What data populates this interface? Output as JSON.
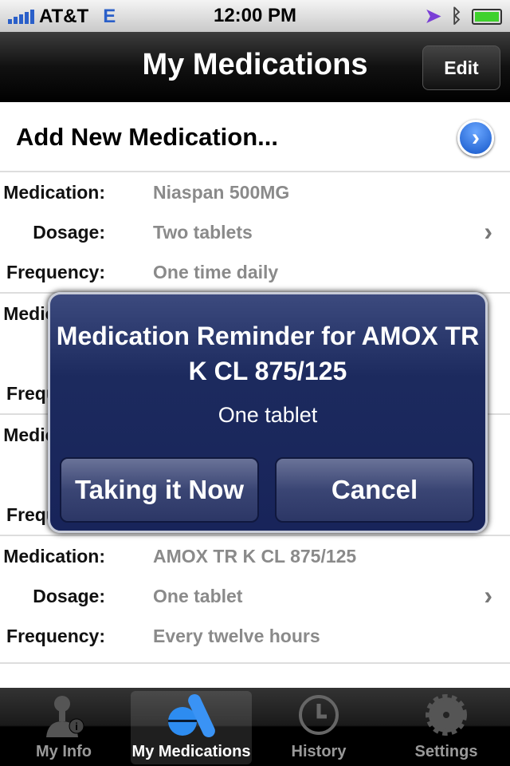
{
  "status": {
    "carrier": "AT&T",
    "network": "E",
    "time": "12:00 PM"
  },
  "nav": {
    "title": "My Medications",
    "edit": "Edit"
  },
  "add": {
    "label": "Add New Medication..."
  },
  "labels": {
    "medication": "Medication:",
    "dosage": "Dosage:",
    "frequency": "Frequency:"
  },
  "meds": [
    {
      "medication": "Niaspan 500MG",
      "dosage": "Two tablets",
      "frequency": "One time daily"
    },
    {
      "medication": "AMOX TR K CL 875/125",
      "dosage": "One tablet",
      "frequency": "Every twelve hours"
    }
  ],
  "alert": {
    "title": "Medication Reminder for AMOX TR K CL 875/125",
    "message": "One tablet",
    "confirm": "Taking it Now",
    "cancel": "Cancel"
  },
  "tabs": [
    {
      "label": "My Info",
      "icon": "person-info-icon"
    },
    {
      "label": "My Medications",
      "icon": "pills-icon",
      "selected": true
    },
    {
      "label": "History",
      "icon": "clock-icon"
    },
    {
      "label": "Settings",
      "icon": "gear-icon"
    }
  ],
  "colors": {
    "accent": "#1456c9",
    "alert_bg": "#1c2a5e",
    "signal": "#2a5fc9",
    "battery": "#3fd12d"
  }
}
